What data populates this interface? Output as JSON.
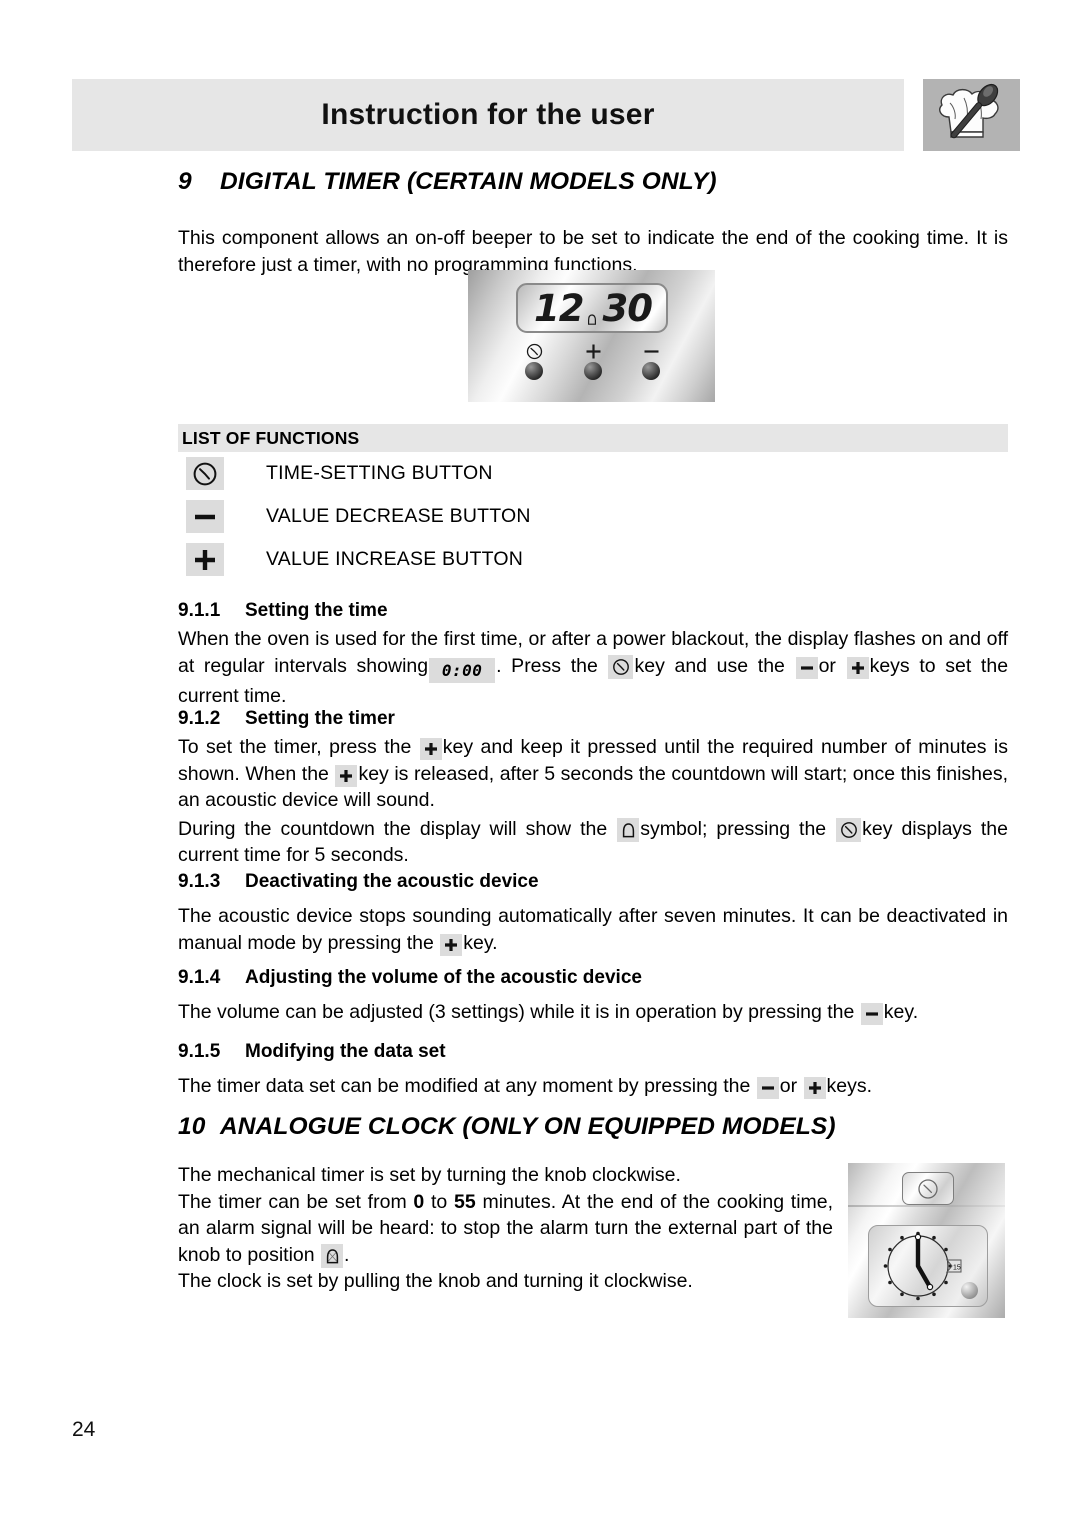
{
  "header": {
    "title": "Instruction for the user",
    "logo_icon": "chef-hat-spoon-icon"
  },
  "sections": {
    "digital_timer": {
      "number": "9",
      "title": "DIGITAL TIMER (CERTAIN MODELS ONLY)",
      "intro": "This component allows an on-off beeper to be set to indicate the end of the cooking time.  It is therefore just a timer, with no programming functions.",
      "panel_image": {
        "display_left": "12",
        "display_right": "30",
        "display_symbol": "bell-icon",
        "buttons": [
          "clock-icon",
          "plus-icon",
          "minus-icon"
        ]
      },
      "list_of_functions": {
        "heading": "LIST OF FUNCTIONS",
        "items": [
          {
            "icon": "clock-icon",
            "label": "TIME-SETTING BUTTON"
          },
          {
            "icon": "minus-icon",
            "label": "VALUE DECREASE BUTTON"
          },
          {
            "icon": "plus-icon",
            "label": "VALUE INCREASE BUTTON"
          }
        ]
      },
      "subsections": [
        {
          "number": "9.1.1",
          "title": "Setting the time",
          "text_1": "When the oven is used for the first time, or after a power blackout, the display flashes on and off at regular intervals showing",
          "zero_value": "0:00",
          "text_2": ". Press the",
          "text_3": "key and use the",
          "text_4": "or",
          "text_5": "keys to set the current time."
        },
        {
          "number": "9.1.2",
          "title": "Setting the timer",
          "p1_a": "To set the timer, press the",
          "p1_b": "key and keep it pressed until the required number of minutes is shown. When the",
          "p1_c": "key is released, after 5 seconds the countdown will start; once this finishes, an acoustic device will sound.",
          "p2_a": "During the countdown the display will show the",
          "p2_b": "symbol; pressing the",
          "p2_c": "key displays the current time for 5 seconds."
        },
        {
          "number": "9.1.3",
          "title": "Deactivating the acoustic device",
          "p1_a": "The acoustic device stops sounding automatically after seven minutes.  It can be deactivated in manual mode by pressing the",
          "p1_b": "key."
        },
        {
          "number": "9.1.4",
          "title": "Adjusting the volume of the acoustic device",
          "p1_a": "The volume can be adjusted (3 settings) while it is in operation by pressing the",
          "p1_b": "key."
        },
        {
          "number": "9.1.5",
          "title": "Modifying the data set",
          "p1_a": "The timer data set can be modified at any moment by pressing the",
          "p1_b": "or",
          "p1_c": "keys."
        }
      ]
    },
    "analogue_clock": {
      "number": "10",
      "title": "ANALOGUE CLOCK (ONLY ON EQUIPPED MODELS)",
      "line_1": "The mechanical timer is set by turning the knob clockwise.",
      "line_2_a": "The timer can be set from",
      "line_2_min": "0",
      "line_2_b": "to",
      "line_2_max": "55",
      "line_2_c": "minutes. At the end of the cooking time, an alarm signal will be heard: to stop the alarm turn the external part of the knob to position",
      "line_2_d": ".",
      "line_3": "The clock is set by pulling the knob and turning it clockwise.",
      "panel_image": {
        "badge_icon": "clock-icon",
        "face_icon": "analogue-clock-face",
        "knob_icon": "knob-icon"
      }
    }
  },
  "footer": {
    "page_number": "24"
  },
  "colors": {
    "header_bar": "#e6e6e6",
    "logo_bg": "#b3b3b3",
    "key_bg": "#dcdcdc",
    "text": "#000000"
  }
}
